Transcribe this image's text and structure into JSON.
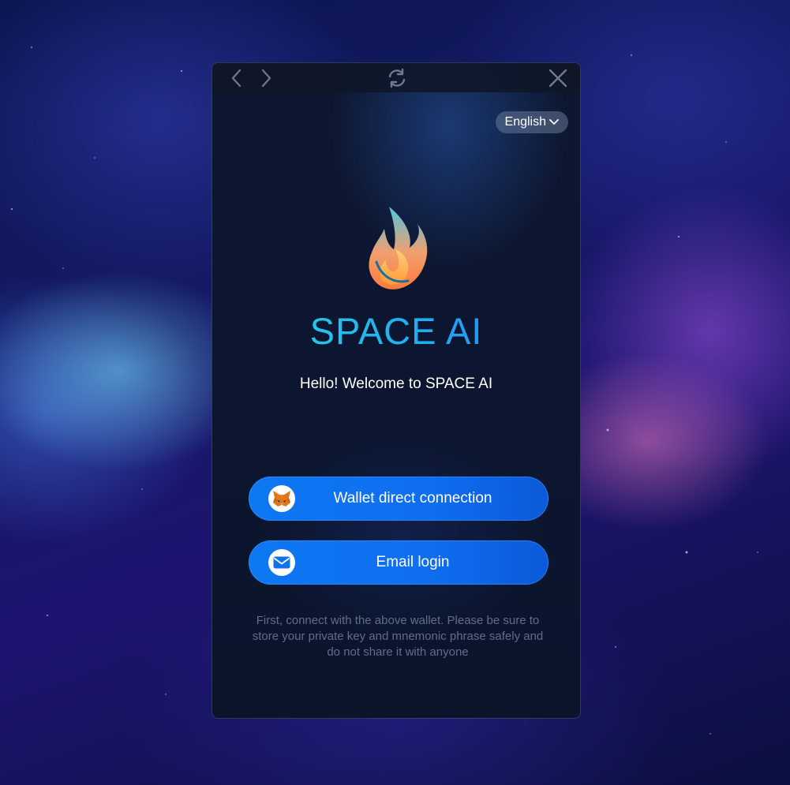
{
  "language": {
    "label": "English"
  },
  "brand": {
    "name": "SPACE AI"
  },
  "welcome": {
    "text": "Hello! Welcome to SPACE AI"
  },
  "buttons": {
    "wallet": {
      "label": "Wallet direct connection",
      "icon": "metamask-fox-icon"
    },
    "email": {
      "label": "Email login",
      "icon": "envelope-icon"
    }
  },
  "note": {
    "text": "First, connect with the above wallet. Please be sure to store your private key and mnemonic phrase safely and do not share it with anyone"
  },
  "colors": {
    "accent": "#0e78f2",
    "brand_gradient_start": "#2ad7e6",
    "brand_gradient_end": "#2a7bff",
    "window_bg": "#0c1630",
    "note_text": "#626d85"
  }
}
